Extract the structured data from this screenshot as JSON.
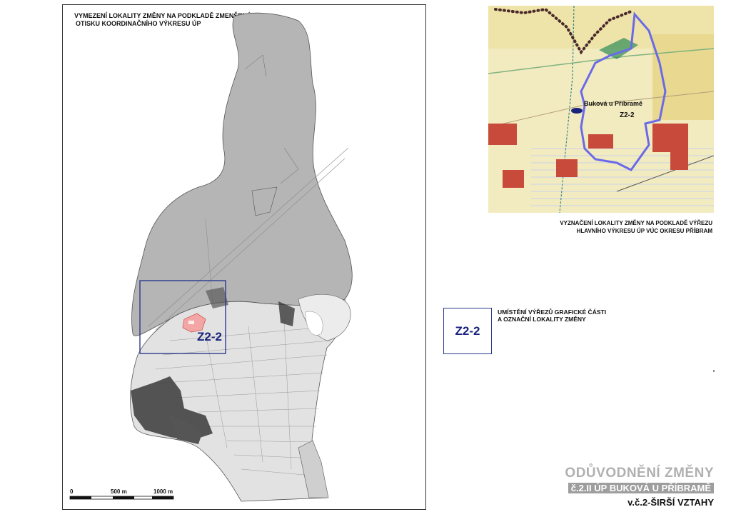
{
  "main_map": {
    "caption_line1": "VYMEZENÍ LOKALITY ZMĚNY NA PODKLADĚ ZMENŠENÉHO",
    "caption_line2": "OTISKU KOORDINAČNÍHO VÝKRESU ÚP",
    "zone_label": "Z2-2",
    "scale": {
      "zero": "0",
      "mid": "500 m",
      "end": "1000 m"
    }
  },
  "inset_map": {
    "place_label": "Buková u Příbramě",
    "zone_label": "Z2-2",
    "caption_line1": "VYZNAČENÍ LOKALITY ZMĚNY NA PODKLADĚ VÝŘEZU",
    "caption_line2": "HLAVNÍHO VÝKRESU ÚP VÚC OKRESU PŘÍBRAM"
  },
  "legend": {
    "box_label": "Z2-2",
    "text_line1": "UMÍSTĚNÍ VÝŘEZŮ GRAFICKÉ ČÁSTI",
    "text_line2": "A OZNAČNÍ LOKALITY ZMĚNY"
  },
  "title_block": {
    "line1": "ODŮVODNĚNÍ ZMĚNY",
    "line2": "č.2.II ÚP BUKOVÁ U PŘÍBRAMĚ",
    "line3": "v.č.2-ŠIRŠÍ VZTAHY"
  },
  "colors": {
    "forest_gray": "#b5b5b5",
    "built_dark": "#3a3a3a",
    "zone_frame": "#2b3a8c",
    "zone_fill": "#f4a6a6",
    "inset_boundary": "#6a6ae8"
  }
}
